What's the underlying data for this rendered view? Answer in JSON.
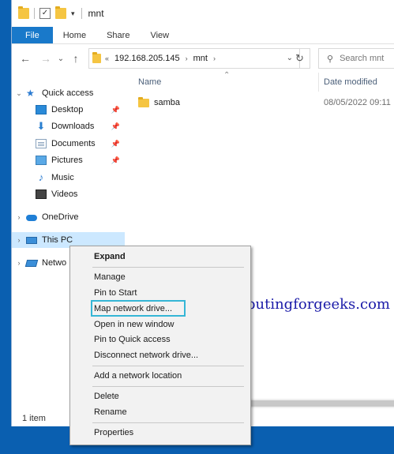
{
  "window": {
    "title": "mnt",
    "qat": {
      "properties_icon": "check-icon",
      "folder_icon": "folder-icon",
      "dropdown": "▾"
    }
  },
  "ribbon": {
    "tabs": [
      {
        "label": "File"
      },
      {
        "label": "Home"
      },
      {
        "label": "Share"
      },
      {
        "label": "View"
      }
    ]
  },
  "address": {
    "back": "←",
    "forward": "→",
    "recent": "⌄",
    "up": "↑",
    "overflow": "«",
    "crumbs": [
      "192.168.205.145",
      "mnt"
    ],
    "search_placeholder": "Search mnt"
  },
  "navpane": {
    "items": [
      {
        "label": "Quick access",
        "icon": "star-icon"
      },
      {
        "label": "Desktop",
        "icon": "desktop-icon",
        "pinned": true
      },
      {
        "label": "Downloads",
        "icon": "download-icon",
        "pinned": true
      },
      {
        "label": "Documents",
        "icon": "document-icon",
        "pinned": true
      },
      {
        "label": "Pictures",
        "icon": "pictures-icon",
        "pinned": true
      },
      {
        "label": "Music",
        "icon": "music-icon"
      },
      {
        "label": "Videos",
        "icon": "video-icon"
      },
      {
        "label": "OneDrive",
        "icon": "cloud-icon"
      },
      {
        "label": "This PC",
        "icon": "computer-icon",
        "selected": true
      },
      {
        "label": "Netwo",
        "icon": "network-icon"
      }
    ]
  },
  "content": {
    "columns": {
      "name": "Name",
      "date": "Date modified"
    },
    "files": [
      {
        "name": "samba",
        "date": "08/05/2022 09:11",
        "icon": "folder-icon"
      }
    ]
  },
  "status": {
    "item_count": "1 item"
  },
  "context_menu": {
    "items": [
      {
        "label": "Expand",
        "bold": true
      },
      {
        "label": "Manage"
      },
      {
        "label": "Pin to Start"
      },
      {
        "label": "Map network drive...",
        "highlighted": true
      },
      {
        "label": "Open in new window"
      },
      {
        "label": "Pin to Quick access"
      },
      {
        "label": "Disconnect network drive..."
      },
      {
        "label": "Add a network location"
      },
      {
        "label": "Delete"
      },
      {
        "label": "Rename"
      },
      {
        "label": "Properties"
      }
    ]
  },
  "watermark": "computingforgeeks.com",
  "colors": {
    "accent": "#1979ca",
    "selection": "#cce8ff",
    "highlight_box": "#35b6d6",
    "desktop_bg": "#0a5fb0"
  }
}
